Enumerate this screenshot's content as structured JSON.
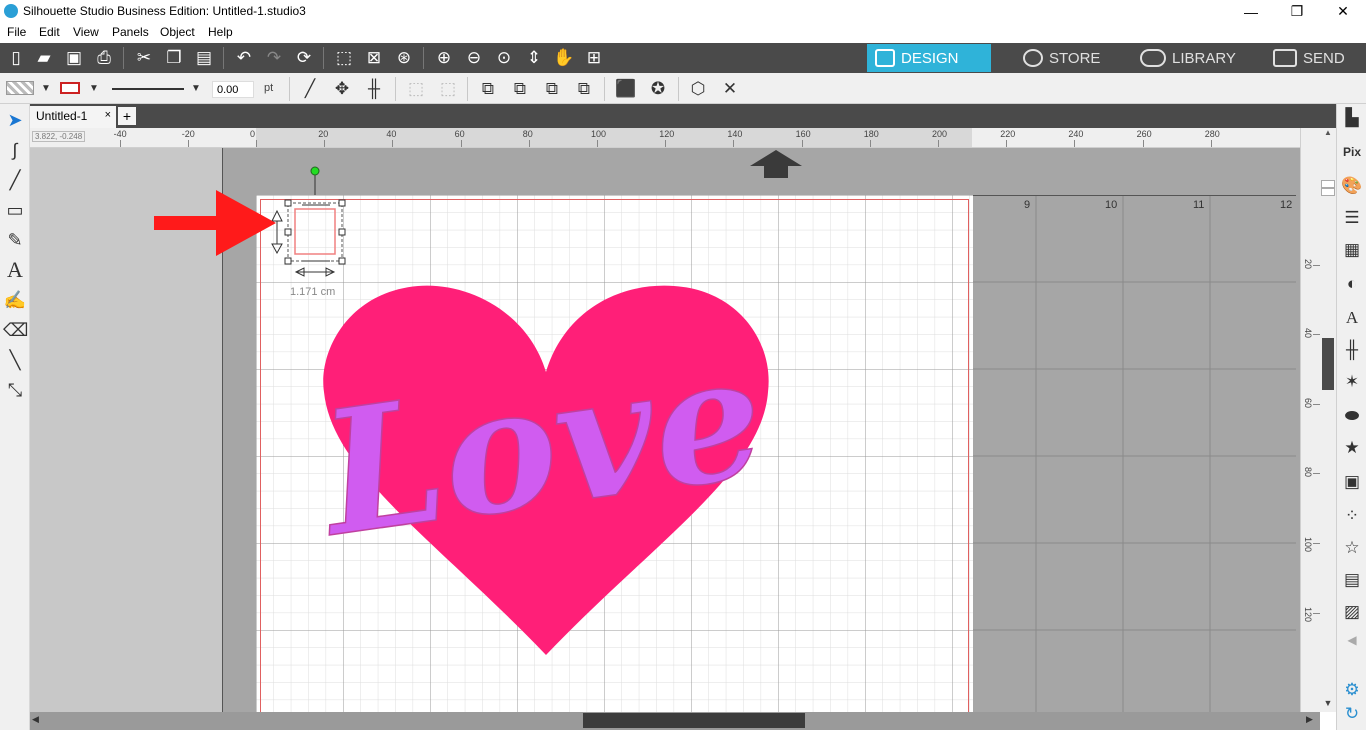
{
  "window": {
    "title": "Silhouette Studio Business Edition: Untitled-1.studio3",
    "minimize": "—",
    "maximize": "❐",
    "close": "✕"
  },
  "menu": [
    "File",
    "Edit",
    "View",
    "Panels",
    "Object",
    "Help"
  ],
  "nav_tabs": [
    {
      "label": "DESIGN",
      "icon": "grid-icon",
      "active": true
    },
    {
      "label": "STORE",
      "icon": "silhouette-s-icon",
      "active": false
    },
    {
      "label": "LIBRARY",
      "icon": "cloud-icon",
      "active": false
    },
    {
      "label": "SEND",
      "icon": "cutter-icon",
      "active": false
    }
  ],
  "toolbar2": {
    "line_width_value": "0.00",
    "line_width_unit": "pt"
  },
  "document": {
    "tab_label": "Untitled-1",
    "close": "×",
    "add": "+"
  },
  "ruler": {
    "coords": "3.822, -0.248",
    "h_labels": [
      "-40",
      "-20",
      "0",
      "20",
      "40",
      "60",
      "80",
      "100",
      "120",
      "140",
      "160",
      "180",
      "200",
      "220",
      "240",
      "260",
      "280"
    ],
    "v_labels": [
      "20",
      "40",
      "60",
      "80",
      "100",
      "120"
    ]
  },
  "grid_labels": [
    "9",
    "10",
    "11",
    "12"
  ],
  "selection": {
    "dimension": "1.171 cm"
  },
  "artwork": {
    "text": "Love",
    "heart_color": "#ff1f78",
    "text_color": "#d05cf0"
  },
  "colors": {
    "accent": "#2fb3d9",
    "toolbar": "#4a4a4a",
    "arrow": "#ff1a1a",
    "page_border": "#e06060"
  }
}
